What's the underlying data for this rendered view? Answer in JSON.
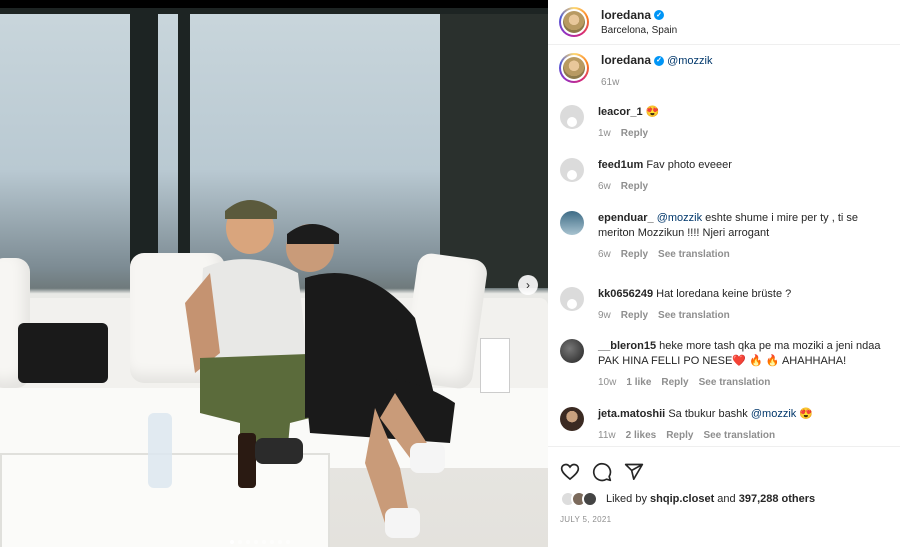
{
  "post": {
    "username": "loredana",
    "location": "Barcelona, Spain"
  },
  "caption": {
    "username": "loredana",
    "mention": "@mozzik",
    "time": "61w"
  },
  "comments": [
    {
      "username": "leacor_1",
      "text": "",
      "emoji": "😍",
      "time": "1w",
      "likes": "",
      "reply": "Reply",
      "translate": ""
    },
    {
      "username": "feed1um",
      "text": "Fav photo eveeer",
      "emoji": "",
      "time": "6w",
      "likes": "",
      "reply": "Reply",
      "translate": ""
    },
    {
      "username": "ependuar_",
      "mention": "@mozzik",
      "text": "eshte shume i mire per ty , ti se meriton Mozzikun !!!! Njeri arrogant",
      "time": "6w",
      "likes": "",
      "reply": "Reply",
      "translate": "See translation"
    },
    {
      "username": "kk0656249",
      "text": "Hat loredana keine brüste ?",
      "time": "9w",
      "likes": "",
      "reply": "Reply",
      "translate": "See translation"
    },
    {
      "username": "__bleron15",
      "text": "heke more tash qka pe ma moziki a jeni ndaa PAK HINA FELLI PO NESE",
      "emoji": "❤️ 🔥 🔥",
      "tail": "AHAHHAHA!",
      "time": "10w",
      "likes": "1 like",
      "reply": "Reply",
      "translate": "See translation"
    },
    {
      "username": "jeta.matoshii",
      "text": "Sa tbukur bashk",
      "mention": "@mozzik",
      "emoji": "😍",
      "time": "11w",
      "likes": "2 likes",
      "reply": "Reply",
      "translate": "See translation"
    }
  ],
  "likes": {
    "prefix": "Liked by",
    "user": "shqip.closet",
    "and": "and",
    "count": "397,288 others"
  },
  "date": "JULY 5, 2021",
  "colors": {
    "accent": "#0095f6",
    "mention": "#00376b",
    "muted": "#8e8e8e"
  }
}
